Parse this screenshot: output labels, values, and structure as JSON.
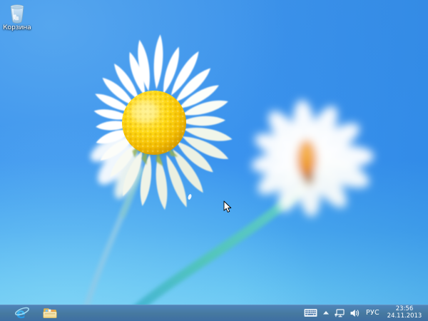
{
  "desktop": {
    "recycle_bin": {
      "label": "Корзина",
      "icon": "recycle-bin-icon"
    },
    "cursor_icon": "arrow-cursor-icon"
  },
  "taskbar": {
    "pinned_apps": [
      {
        "id": "internet-explorer",
        "icon": "internet-explorer-icon"
      },
      {
        "id": "file-explorer",
        "icon": "file-explorer-icon"
      }
    ],
    "tray": {
      "keyboard_icon": "touch-keyboard-icon",
      "hidden_icons_icon": "chevron-up-icon",
      "network_icon": "network-status-icon",
      "volume_icon": "speaker-icon",
      "language_indicator": "РУС",
      "clock": {
        "time": "23:56",
        "date": "24.11.2013"
      }
    }
  },
  "wallpaper": {
    "description": "windows-8-daisy-wallpaper",
    "colors": {
      "sky_top": "#3C92EA",
      "sky_bottom": "#72CCF4",
      "daisy_center_yellow": "#FCD310",
      "blurred_daisy_center_orange": "#E8861C",
      "stem_teal": "#52C6B8",
      "petal_white": "#FFFFFF"
    }
  },
  "colors": {
    "taskbar_top": "#4F86BC",
    "taskbar_bottom": "#3E6FA3",
    "tray_icon_white": "#F2F7FB"
  }
}
